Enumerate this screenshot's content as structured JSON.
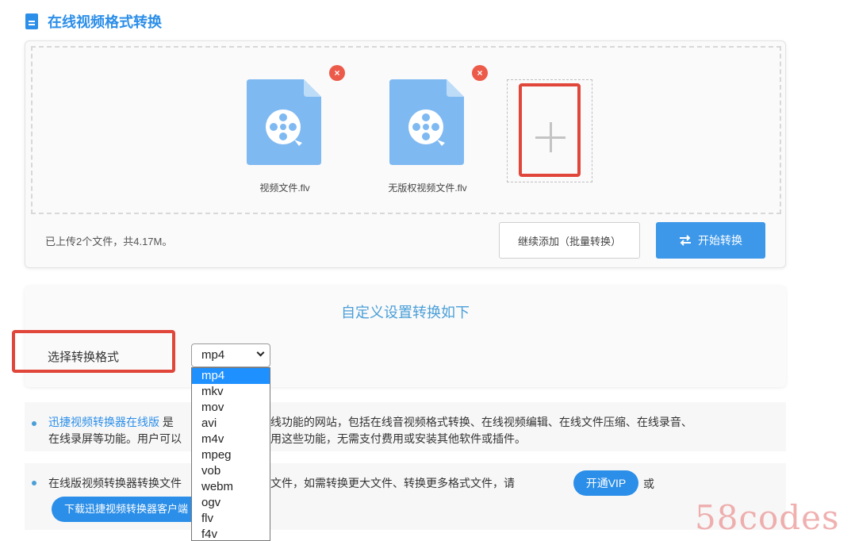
{
  "header": {
    "title": "在线视频格式转换",
    "icon": "document-icon"
  },
  "upload": {
    "files": [
      {
        "name": "视频文件.flv"
      },
      {
        "name": "无版权视频文件.flv"
      }
    ],
    "delete_icon_label": "×",
    "info": "已上传2个文件，共4.17M。",
    "continue_label": "继续添加（批量转换）",
    "start_label": "开始转换"
  },
  "settings": {
    "title": "自定义设置转换如下",
    "format_label": "选择转换格式",
    "selected_format": "mp4",
    "options": [
      "mp4",
      "mkv",
      "mov",
      "avi",
      "m4v",
      "mpeg",
      "vob",
      "webm",
      "ogv",
      "flv",
      "f4v"
    ]
  },
  "info": {
    "line1_link": "迅捷视频转换器在线版",
    "line1_a": " 是",
    "line1_b": "供在线功能的网站，包括在线音视频格式转换、在线视频编辑、在线文件压缩、在线录音、",
    "line2_a": "在线录屏等功能。用户可以",
    "line2_b": "免费试用这些功能，无需支付费用或安装其他软件或插件。",
    "line3_a": "在线版视频转换器转换文件",
    "line3_b": "以内文件，如需转换更大文件、转换更多格式文件，请",
    "vip_label": "开通VIP",
    "or_text": "或",
    "download_label": "下载迅捷视频转换器客户端"
  },
  "watermark": "58codes",
  "colors": {
    "accent": "#2b8ee8",
    "highlight": "#e0463a",
    "file": "#7fb9f2",
    "delete": "#ec5a4a"
  }
}
